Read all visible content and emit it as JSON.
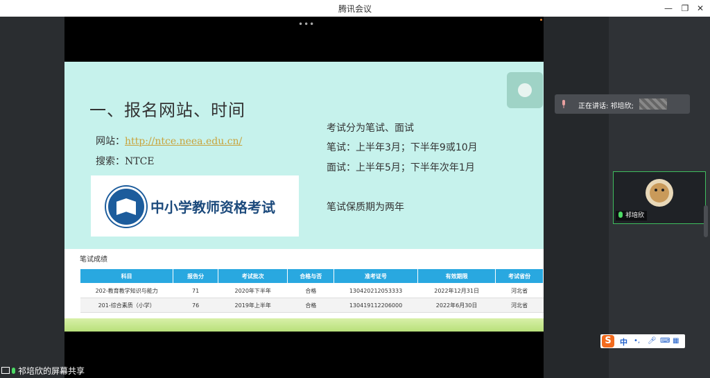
{
  "window": {
    "title": "腾讯会议"
  },
  "slide": {
    "heading": "一、报名网站、时间",
    "website_label": "网站：",
    "website_url": "http://ntce.neea.edu.cn/",
    "search_label": "搜索：NTCE",
    "logo_text": "中小学教师资格考试",
    "exam_type": "考试分为笔试、面试",
    "written_time": "笔试：上半年3月；下半年9或10月",
    "interview_time": "面试：上半年5月；下半年次年1月",
    "validity": "笔试保质期为两年"
  },
  "scores": {
    "title": "笔试成绩",
    "headers": [
      "科目",
      "报告分",
      "考试批次",
      "合格与否",
      "准考证号",
      "有效期限",
      "考试省份"
    ],
    "rows": [
      [
        "202-教育教学知识与能力",
        "71",
        "2020年下半年",
        "合格",
        "130420212053333",
        "2022年12月31日",
        "河北省"
      ],
      [
        "201-综合素质（小学）",
        "76",
        "2019年上半年",
        "合格",
        "130419112206000",
        "2022年6月30日",
        "河北省"
      ]
    ]
  },
  "meeting": {
    "speaking_label": "正在讲话: 祁培欣;",
    "participant_name": "祁培欣",
    "share_label": "祁培欣的屏幕共享"
  },
  "ime": {
    "mode": "中"
  },
  "colors": {
    "table_header": "#29a8e0",
    "active_border": "#3fbf5f",
    "slide_bg": "#c6f2ec"
  }
}
